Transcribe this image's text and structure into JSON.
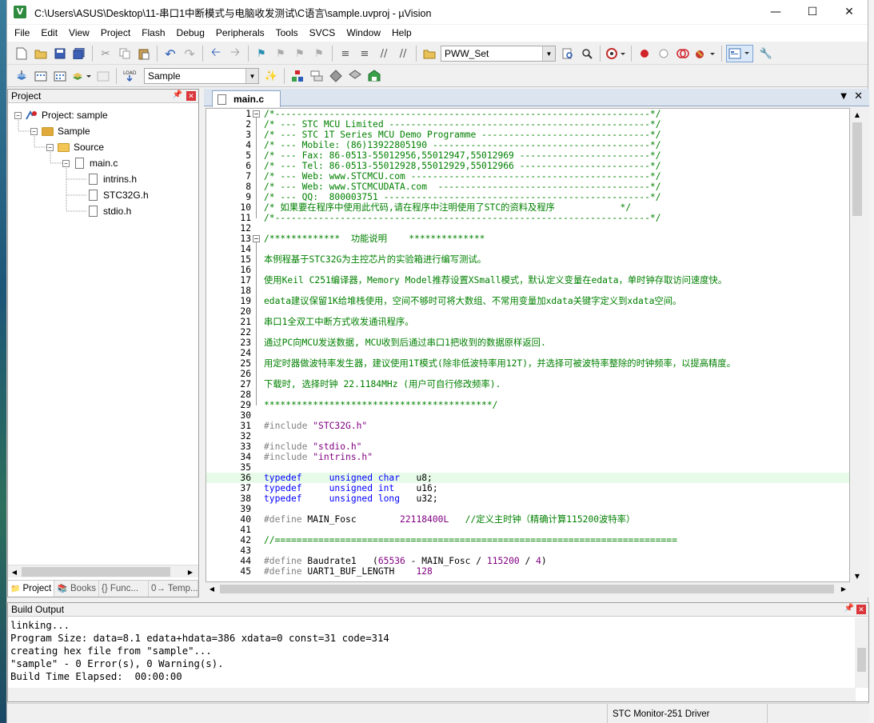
{
  "window": {
    "title": "C:\\Users\\ASUS\\Desktop\\11-串口1中断模式与电脑收发测试\\C语言\\sample.uvproj - µVision"
  },
  "menu": [
    "File",
    "Edit",
    "View",
    "Project",
    "Flash",
    "Debug",
    "Peripherals",
    "Tools",
    "SVCS",
    "Window",
    "Help"
  ],
  "toolbar1": {
    "combo_value": "PWW_Set"
  },
  "toolbar2": {
    "target_value": "Sample"
  },
  "project_panel": {
    "title": "Project",
    "tree": [
      {
        "label": "Project: sample",
        "level": 0,
        "kind": "project",
        "expanded": true
      },
      {
        "label": "Sample",
        "level": 1,
        "kind": "target",
        "expanded": true
      },
      {
        "label": "Source",
        "level": 2,
        "kind": "folder",
        "expanded": true
      },
      {
        "label": "main.c",
        "level": 3,
        "kind": "file",
        "expanded": true
      },
      {
        "label": "intrins.h",
        "level": 4,
        "kind": "header"
      },
      {
        "label": "STC32G.h",
        "level": 4,
        "kind": "header"
      },
      {
        "label": "stdio.h",
        "level": 4,
        "kind": "header"
      }
    ],
    "tabs": [
      "Project",
      "Books",
      "{} Func...",
      "0→ Temp..."
    ]
  },
  "editor": {
    "tab_label": "main.c",
    "lines": [
      {
        "n": "1",
        "t": "/*---------------------------------------------------------------------*/",
        "c": "cmt"
      },
      {
        "n": "2",
        "t": "/* --- STC MCU Limited ------------------------------------------------*/",
        "c": "cmt"
      },
      {
        "n": "3",
        "t": "/* --- STC 1T Series MCU Demo Programme -------------------------------*/",
        "c": "cmt"
      },
      {
        "n": "4",
        "t": "/* --- Mobile: (86)13922805190 ----------------------------------------*/",
        "c": "cmt"
      },
      {
        "n": "5",
        "t": "/* --- Fax: 86-0513-55012956,55012947,55012969 ------------------------*/",
        "c": "cmt"
      },
      {
        "n": "6",
        "t": "/* --- Tel: 86-0513-55012928,55012929,55012966 ------------------------*/",
        "c": "cmt"
      },
      {
        "n": "7",
        "t": "/* --- Web: www.STCMCU.com --------------------------------------------*/",
        "c": "cmt"
      },
      {
        "n": "8",
        "t": "/* --- Web: www.STCMCUDATA.com  ---------------------------------------*/",
        "c": "cmt"
      },
      {
        "n": "9",
        "t": "/* --- QQ:  800003751 -------------------------------------------------*/",
        "c": "cmt"
      },
      {
        "n": "10",
        "t": "/* 如果要在程序中使用此代码,请在程序中注明使用了STC的资料及程序            */",
        "c": "cmt"
      },
      {
        "n": "11",
        "t": "/*---------------------------------------------------------------------*/",
        "c": "cmt"
      },
      {
        "n": "12",
        "t": "",
        "c": "txt"
      },
      {
        "n": "13",
        "t": "/*************  功能说明    **************",
        "c": "cmt"
      },
      {
        "n": "14",
        "t": "",
        "c": "txt"
      },
      {
        "n": "15",
        "t": "本例程基于STC32G为主控芯片的实验箱进行编写测试。",
        "c": "cmt"
      },
      {
        "n": "16",
        "t": "",
        "c": "txt"
      },
      {
        "n": "17",
        "t": "使用Keil C251编译器，Memory Model推荐设置XSmall模式，默认定义变量在edata，单时钟存取访问速度快。",
        "c": "cmt"
      },
      {
        "n": "18",
        "t": "",
        "c": "txt"
      },
      {
        "n": "19",
        "t": "edata建议保留1K给堆栈使用，空间不够时可将大数组、不常用变量加xdata关键字定义到xdata空间。",
        "c": "cmt"
      },
      {
        "n": "20",
        "t": "",
        "c": "txt"
      },
      {
        "n": "21",
        "t": "串口1全双工中断方式收发通讯程序。",
        "c": "cmt"
      },
      {
        "n": "22",
        "t": "",
        "c": "txt"
      },
      {
        "n": "23",
        "t": "通过PC向MCU发送数据, MCU收到后通过串口1把收到的数据原样返回.",
        "c": "cmt"
      },
      {
        "n": "24",
        "t": "",
        "c": "txt"
      },
      {
        "n": "25",
        "t": "用定时器做波特率发生器，建议使用1T模式(除非低波特率用12T)，并选择可被波特率整除的时钟频率，以提高精度。",
        "c": "cmt"
      },
      {
        "n": "26",
        "t": "",
        "c": "txt"
      },
      {
        "n": "27",
        "t": "下载时, 选择时钟 22.1184MHz (用户可自行修改频率).",
        "c": "cmt"
      },
      {
        "n": "28",
        "t": "",
        "c": "txt"
      },
      {
        "n": "29",
        "t": "******************************************/",
        "c": "cmt"
      },
      {
        "n": "30",
        "t": "",
        "c": "txt"
      },
      {
        "n": "31",
        "t": "",
        "c": "txt",
        "parts": [
          [
            "pp",
            "#include "
          ],
          [
            "str",
            "\"STC32G.h\""
          ]
        ]
      },
      {
        "n": "32",
        "t": "",
        "c": "txt"
      },
      {
        "n": "33",
        "t": "",
        "c": "txt",
        "parts": [
          [
            "pp",
            "#include "
          ],
          [
            "str",
            "\"stdio.h\""
          ]
        ]
      },
      {
        "n": "34",
        "t": "",
        "c": "txt",
        "parts": [
          [
            "pp",
            "#include "
          ],
          [
            "str",
            "\"intrins.h\""
          ]
        ]
      },
      {
        "n": "35",
        "t": "",
        "c": "txt"
      },
      {
        "n": "36",
        "t": "",
        "c": "txt",
        "hl": true,
        "parts": [
          [
            "kw",
            "typedef     unsigned char"
          ],
          [
            "txt",
            "   u8;"
          ]
        ]
      },
      {
        "n": "37",
        "t": "",
        "c": "txt",
        "parts": [
          [
            "kw",
            "typedef     unsigned int"
          ],
          [
            "txt",
            "    u16;"
          ]
        ]
      },
      {
        "n": "38",
        "t": "",
        "c": "txt",
        "parts": [
          [
            "kw",
            "typedef     unsigned long"
          ],
          [
            "txt",
            "   u32;"
          ]
        ]
      },
      {
        "n": "39",
        "t": "",
        "c": "txt"
      },
      {
        "n": "40",
        "t": "",
        "c": "txt",
        "parts": [
          [
            "pp",
            "#define "
          ],
          [
            "txt",
            "MAIN_Fosc        "
          ],
          [
            "num",
            "22118400L"
          ],
          [
            "cmt",
            "   //定义主时钟（精确计算115200波特率）"
          ]
        ]
      },
      {
        "n": "41",
        "t": "",
        "c": "txt"
      },
      {
        "n": "42",
        "t": "//==========================================================================",
        "c": "cmt"
      },
      {
        "n": "43",
        "t": "",
        "c": "txt"
      },
      {
        "n": "44",
        "t": "",
        "c": "txt",
        "parts": [
          [
            "pp",
            "#define "
          ],
          [
            "txt",
            "Baudrate1   ("
          ],
          [
            "num",
            "65536"
          ],
          [
            "txt",
            " - MAIN_Fosc / "
          ],
          [
            "num",
            "115200"
          ],
          [
            "txt",
            " / "
          ],
          [
            "num",
            "4"
          ],
          [
            "txt",
            ")"
          ]
        ]
      },
      {
        "n": "45",
        "t": "",
        "c": "txt",
        "parts": [
          [
            "pp",
            "#define "
          ],
          [
            "txt",
            "UART1_BUF_LENGTH    "
          ],
          [
            "num",
            "128"
          ]
        ]
      }
    ]
  },
  "build_output": {
    "title": "Build Output",
    "lines": [
      "linking...",
      "Program Size: data=8.1 edata+hdata=386 xdata=0 const=31 code=314",
      "creating hex file from \"sample\"...",
      "\"sample\" - 0 Error(s), 0 Warning(s).",
      "Build Time Elapsed:  00:00:00"
    ]
  },
  "status": {
    "driver": "STC Monitor-251 Driver"
  }
}
